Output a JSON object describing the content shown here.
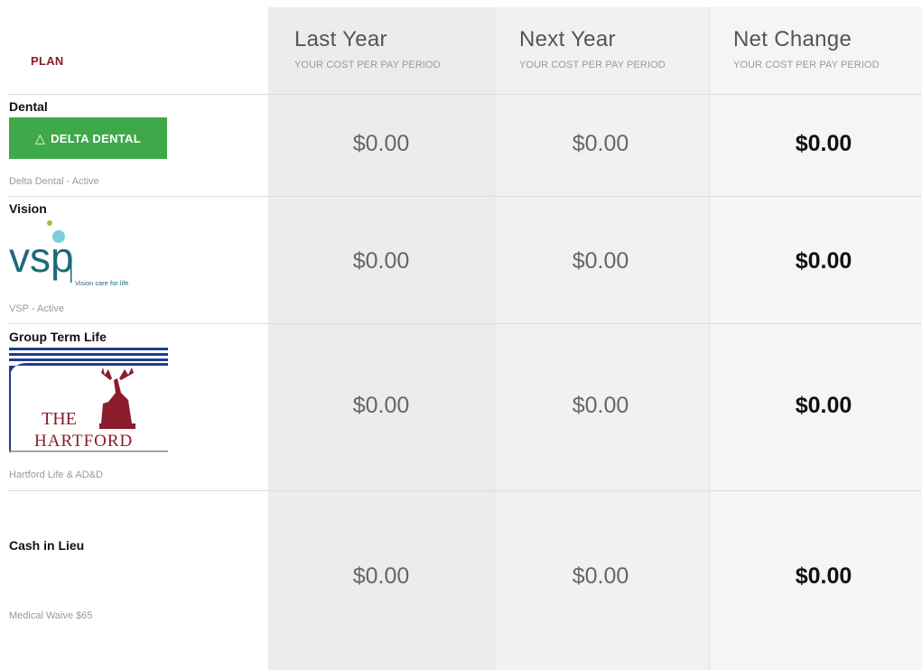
{
  "header": {
    "plan_label": "PLAN",
    "columns": [
      {
        "title": "Last Year",
        "subtitle": "YOUR COST PER PAY PERIOD"
      },
      {
        "title": "Next Year",
        "subtitle": "YOUR COST PER PAY PERIOD"
      },
      {
        "title": "Net Change",
        "subtitle": "YOUR COST PER PAY PERIOD"
      }
    ]
  },
  "rows": [
    {
      "title": "Dental",
      "logo": {
        "text": "DELTA DENTAL",
        "color": "#3fa94a"
      },
      "status": "Delta Dental - Active",
      "last_year": "$0.00",
      "next_year": "$0.00",
      "net_change": "$0.00"
    },
    {
      "title": "Vision",
      "logo": {
        "text": "vsp",
        "tagline": "Vision care for life",
        "color": "#1c6b78"
      },
      "status": "VSP - Active",
      "last_year": "$0.00",
      "next_year": "$0.00",
      "net_change": "$0.00"
    },
    {
      "title": "Group Term Life",
      "logo": {
        "text_line1": "THE",
        "text_line2": "HARTFORD",
        "color": "#8b1c2c"
      },
      "status": "Hartford Life & AD&D",
      "last_year": "$0.00",
      "next_year": "$0.00",
      "net_change": "$0.00"
    },
    {
      "title": "Cash in Lieu",
      "status": "Medical Waive $65",
      "last_year": "$0.00",
      "next_year": "$0.00",
      "net_change": "$0.00"
    }
  ]
}
